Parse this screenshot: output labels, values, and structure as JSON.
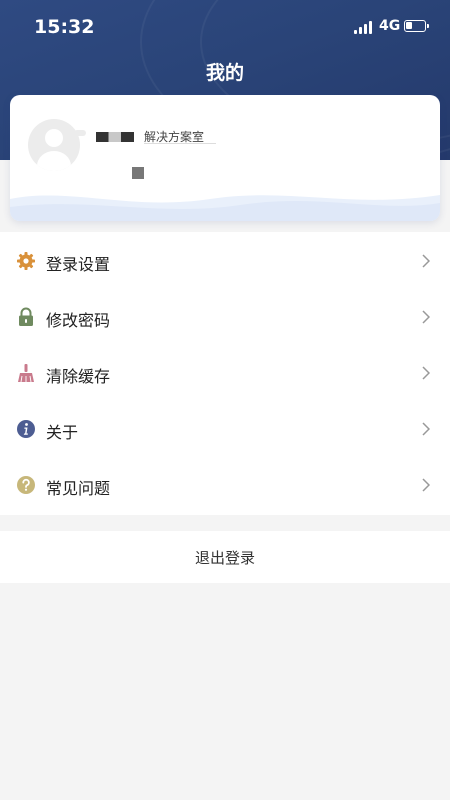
{
  "status_bar": {
    "time": "15:32",
    "network": "4G",
    "battery_percent": 35
  },
  "header": {
    "title": "我的"
  },
  "profile": {
    "org_label": "解决方案室",
    "name_redacted": true,
    "id_redacted": true
  },
  "menu": {
    "items": [
      {
        "label": "登录设置",
        "icon": "gear-icon",
        "color": "#d9913a"
      },
      {
        "label": "修改密码",
        "icon": "lock-icon",
        "color": "#6f8a5f"
      },
      {
        "label": "清除缓存",
        "icon": "broom-icon",
        "color": "#c97a8c"
      },
      {
        "label": "关于",
        "icon": "info-icon",
        "color": "#4d5d92"
      },
      {
        "label": "常见问题",
        "icon": "question-icon",
        "color": "#c7b77a"
      }
    ]
  },
  "logout": {
    "label": "退出登录"
  },
  "colors": {
    "header_bg": "#2a4478",
    "page_bg": "#f4f4f4",
    "card_bg": "#ffffff"
  }
}
